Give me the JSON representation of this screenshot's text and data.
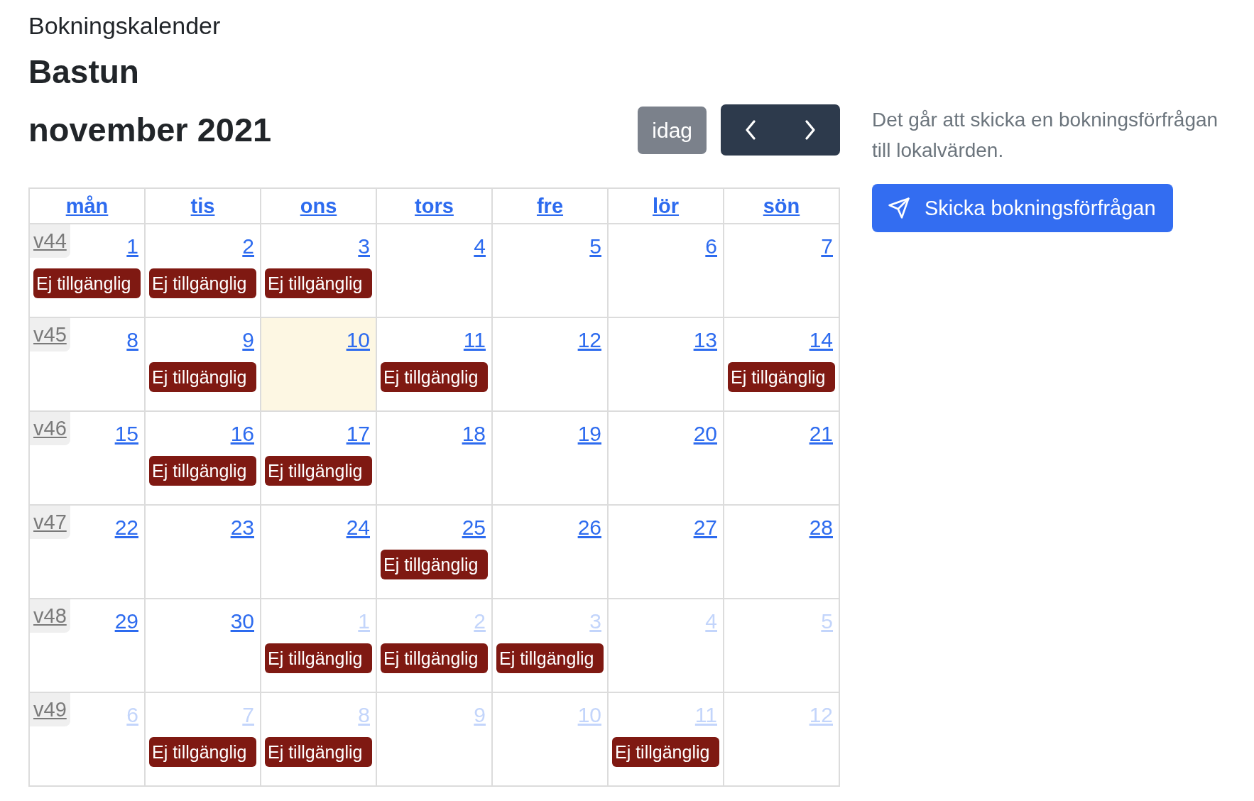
{
  "header": {
    "app_title": "Bokningskalender",
    "resource_name": "Bastun"
  },
  "toolbar": {
    "month_label": "november 2021",
    "today_button": "idag"
  },
  "calendar": {
    "weekdays": [
      "mån",
      "tis",
      "ons",
      "tors",
      "fre",
      "lör",
      "sön"
    ],
    "weeks": [
      {
        "week_label": "v44",
        "days": [
          {
            "day": "1",
            "other_month": false,
            "today": false,
            "events": [
              {
                "label": "Ej tillgänglig"
              }
            ]
          },
          {
            "day": "2",
            "other_month": false,
            "today": false,
            "events": [
              {
                "label": "Ej tillgänglig"
              }
            ]
          },
          {
            "day": "3",
            "other_month": false,
            "today": false,
            "events": [
              {
                "label": "Ej tillgänglig"
              }
            ]
          },
          {
            "day": "4",
            "other_month": false,
            "today": false
          },
          {
            "day": "5",
            "other_month": false,
            "today": false
          },
          {
            "day": "6",
            "other_month": false,
            "today": false
          },
          {
            "day": "7",
            "other_month": false,
            "today": false
          }
        ]
      },
      {
        "week_label": "v45",
        "days": [
          {
            "day": "8",
            "other_month": false,
            "today": false
          },
          {
            "day": "9",
            "other_month": false,
            "today": false,
            "events": [
              {
                "label": "Ej tillgänglig"
              }
            ]
          },
          {
            "day": "10",
            "other_month": false,
            "today": true
          },
          {
            "day": "11",
            "other_month": false,
            "today": false,
            "events": [
              {
                "label": "Ej tillgänglig"
              }
            ]
          },
          {
            "day": "12",
            "other_month": false,
            "today": false
          },
          {
            "day": "13",
            "other_month": false,
            "today": false
          },
          {
            "day": "14",
            "other_month": false,
            "today": false,
            "events": [
              {
                "label": "Ej tillgänglig"
              }
            ]
          }
        ]
      },
      {
        "week_label": "v46",
        "days": [
          {
            "day": "15",
            "other_month": false,
            "today": false
          },
          {
            "day": "16",
            "other_month": false,
            "today": false,
            "events": [
              {
                "label": "Ej tillgänglig"
              }
            ]
          },
          {
            "day": "17",
            "other_month": false,
            "today": false,
            "events": [
              {
                "label": "Ej tillgänglig"
              }
            ]
          },
          {
            "day": "18",
            "other_month": false,
            "today": false
          },
          {
            "day": "19",
            "other_month": false,
            "today": false
          },
          {
            "day": "20",
            "other_month": false,
            "today": false
          },
          {
            "day": "21",
            "other_month": false,
            "today": false
          }
        ]
      },
      {
        "week_label": "v47",
        "days": [
          {
            "day": "22",
            "other_month": false,
            "today": false
          },
          {
            "day": "23",
            "other_month": false,
            "today": false
          },
          {
            "day": "24",
            "other_month": false,
            "today": false
          },
          {
            "day": "25",
            "other_month": false,
            "today": false,
            "events": [
              {
                "label": "Ej tillgänglig"
              }
            ]
          },
          {
            "day": "26",
            "other_month": false,
            "today": false
          },
          {
            "day": "27",
            "other_month": false,
            "today": false
          },
          {
            "day": "28",
            "other_month": false,
            "today": false
          }
        ]
      },
      {
        "week_label": "v48",
        "days": [
          {
            "day": "29",
            "other_month": false,
            "today": false
          },
          {
            "day": "30",
            "other_month": false,
            "today": false
          },
          {
            "day": "1",
            "other_month": true,
            "today": false,
            "events": [
              {
                "label": "Ej tillgänglig"
              }
            ]
          },
          {
            "day": "2",
            "other_month": true,
            "today": false,
            "events": [
              {
                "label": "Ej tillgänglig"
              }
            ]
          },
          {
            "day": "3",
            "other_month": true,
            "today": false,
            "events": [
              {
                "label": "Ej tillgänglig"
              }
            ]
          },
          {
            "day": "4",
            "other_month": true,
            "today": false
          },
          {
            "day": "5",
            "other_month": true,
            "today": false
          }
        ]
      },
      {
        "week_label": "v49",
        "days": [
          {
            "day": "6",
            "other_month": true,
            "today": false
          },
          {
            "day": "7",
            "other_month": true,
            "today": false,
            "events": [
              {
                "label": "Ej tillgänglig"
              }
            ]
          },
          {
            "day": "8",
            "other_month": true,
            "today": false,
            "events": [
              {
                "label": "Ej tillgänglig"
              }
            ]
          },
          {
            "day": "9",
            "other_month": true,
            "today": false
          },
          {
            "day": "10",
            "other_month": true,
            "today": false
          },
          {
            "day": "11",
            "other_month": true,
            "today": false,
            "events": [
              {
                "label": "Ej tillgänglig"
              }
            ]
          },
          {
            "day": "12",
            "other_month": true,
            "today": false
          }
        ]
      }
    ]
  },
  "request_panel": {
    "info_text": "Det går att skicka en bokningsförfrågan till lokalvärden.",
    "button_label": "Skicka bokningsförfrågan"
  }
}
